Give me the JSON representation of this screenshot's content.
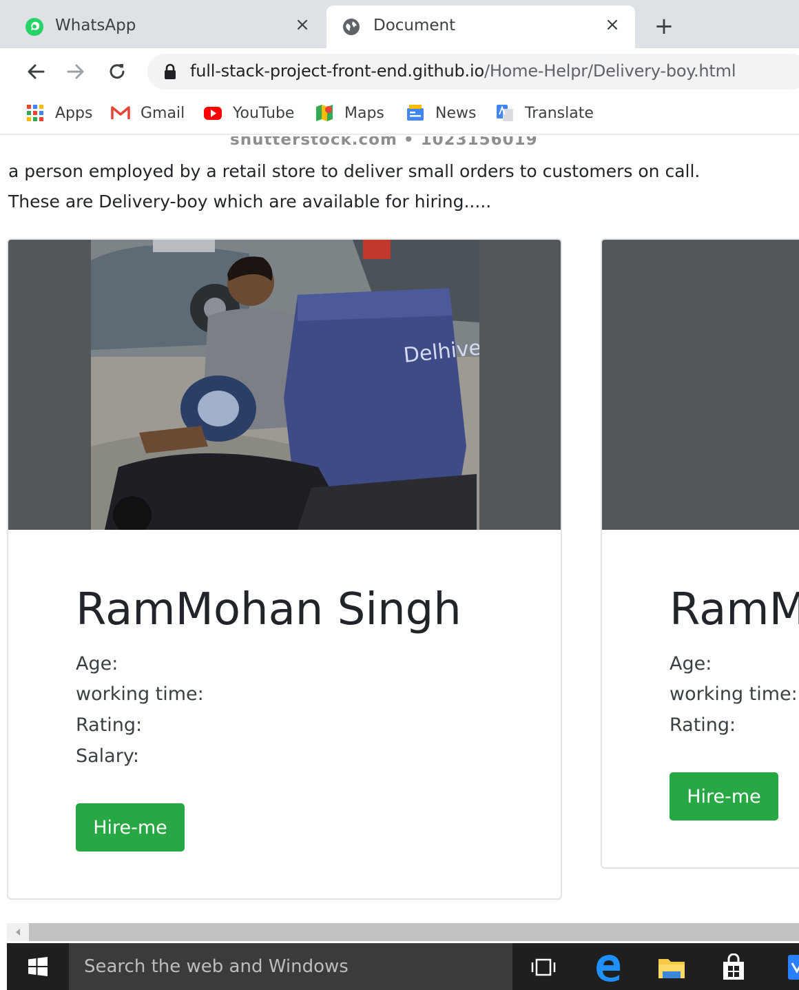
{
  "browser": {
    "tabs": [
      {
        "title": "WhatsApp",
        "icon": "whatsapp-icon",
        "active": false
      },
      {
        "title": "Document",
        "icon": "globe-icon",
        "active": true
      }
    ],
    "close_glyph": "×",
    "new_tab_glyph": "+",
    "url_host": "full-stack-project-front-end.github.io",
    "url_path": "/Home-Helpr/Delivery-boy.html",
    "bookmarks": [
      {
        "label": "Apps",
        "icon": "apps-grid-icon"
      },
      {
        "label": "Gmail",
        "icon": "gmail-icon"
      },
      {
        "label": "YouTube",
        "icon": "youtube-icon"
      },
      {
        "label": "Maps",
        "icon": "maps-icon"
      },
      {
        "label": "News",
        "icon": "news-icon"
      },
      {
        "label": "Translate",
        "icon": "translate-icon"
      }
    ]
  },
  "page": {
    "watermark": "shutterstock.com • 1023156019",
    "intro_line1": "a person employed by a retail store to deliver small orders to customers on call.",
    "intro_line2": "These are Delivery-boy which are available for hiring.....",
    "cards": [
      {
        "name": "RamMohan Singh",
        "fields": [
          "Age:",
          "working time:",
          "Rating:",
          "Salary:"
        ],
        "button": "Hire-me"
      },
      {
        "name": "RamM",
        "fields": [
          "Age:",
          "working time:",
          "Rating:"
        ],
        "button": "Hire-me"
      }
    ],
    "bag_text": "Delhive"
  },
  "taskbar": {
    "search_placeholder": "Search the web and Windows"
  },
  "colors": {
    "hire_button": "#28a745",
    "image_background": "#54575a",
    "tabstrip": "#dee1e6",
    "omnibox": "#f1f3f4"
  }
}
